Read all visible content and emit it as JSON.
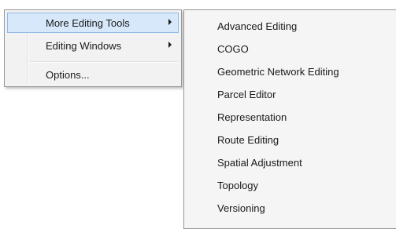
{
  "main_menu": {
    "items": [
      {
        "label": "More Editing Tools",
        "has_submenu": true,
        "highlighted": true
      },
      {
        "label": "Editing Windows",
        "has_submenu": true,
        "highlighted": false
      },
      {
        "label": "Options...",
        "has_submenu": false,
        "highlighted": false
      }
    ]
  },
  "submenu": {
    "items": [
      {
        "label": "Advanced Editing"
      },
      {
        "label": "COGO"
      },
      {
        "label": "Geometric Network Editing"
      },
      {
        "label": "Parcel Editor"
      },
      {
        "label": "Representation"
      },
      {
        "label": "Route Editing"
      },
      {
        "label": "Spatial Adjustment"
      },
      {
        "label": "Topology"
      },
      {
        "label": "Versioning"
      }
    ]
  },
  "colors": {
    "menu_background": "#f2f2f2",
    "highlight_fill": "#d7e8fa",
    "highlight_border": "#8fb8e6",
    "menu_border": "#979797"
  },
  "icons": {
    "submenu_arrow": "triangle-right"
  }
}
